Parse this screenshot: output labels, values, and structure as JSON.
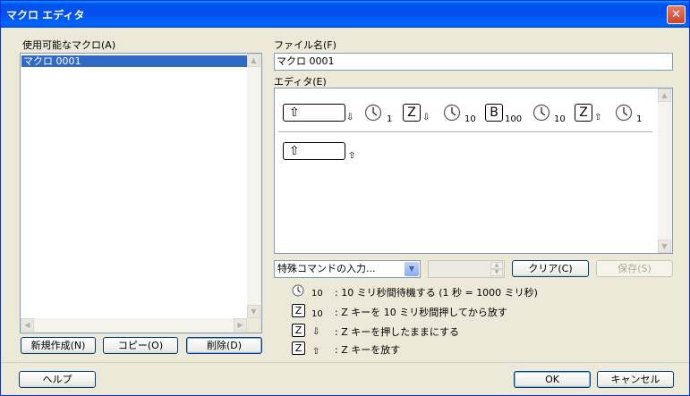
{
  "window": {
    "title": "マクロ エディタ",
    "close_glyph": "✕"
  },
  "macro_list": {
    "label": "使用可能なマクロ(A)",
    "items": [
      "マクロ 0001"
    ],
    "selected_index": 0
  },
  "list_buttons": {
    "new_label": "新規作成(N)",
    "copy_label": "コピー(O)",
    "delete_label": "削除(D)"
  },
  "filename": {
    "label": "ファイル名(F)",
    "value": "マクロ 0001"
  },
  "editor": {
    "label": "エディタ(E)",
    "row1": [
      {
        "type": "key",
        "icon": "shift-arrow-icon",
        "glyph": "⇧",
        "action": "down",
        "arrow": "⇩"
      },
      {
        "type": "wait",
        "icon": "clock-icon",
        "value": "1"
      },
      {
        "type": "key",
        "icon": "key-z-icon",
        "glyph": "Z",
        "action": "down",
        "arrow": "⇩"
      },
      {
        "type": "wait",
        "icon": "clock-icon",
        "value": "10"
      },
      {
        "type": "key",
        "icon": "key-b-icon",
        "glyph": "B",
        "value": "100"
      },
      {
        "type": "wait",
        "icon": "clock-icon",
        "value": "10"
      },
      {
        "type": "key",
        "icon": "key-z-icon",
        "glyph": "Z",
        "action": "up",
        "arrow": "⇧"
      },
      {
        "type": "wait",
        "icon": "clock-icon",
        "value": "1"
      }
    ],
    "row2": [
      {
        "type": "key",
        "icon": "shift-arrow-icon",
        "glyph": "⇧",
        "action": "up",
        "arrow": "⇧"
      }
    ]
  },
  "special_command": {
    "placeholder": "特殊コマンドの入力..."
  },
  "editor_buttons": {
    "clear_label": "クリア(C)",
    "save_label": "保存(S)"
  },
  "legend": [
    {
      "icon": "clock-icon",
      "glyph": "",
      "num": "10",
      "text": ": 10 ミリ秒間待機する (1 秒 = 1000 ミリ秒)"
    },
    {
      "icon": "key-z-icon",
      "glyph": "Z",
      "num": "10",
      "text": ": Z キーを 10 ミリ秒間押してから放す"
    },
    {
      "icon": "key-z-icon",
      "glyph": "Z",
      "num": "⇩",
      "text": ": Z キーを押したままにする"
    },
    {
      "icon": "key-z-icon",
      "glyph": "Z",
      "num": "⇧",
      "text": ": Z キーを放す"
    }
  ],
  "footer": {
    "help_label": "ヘルプ",
    "ok_label": "OK",
    "cancel_label": "キャンセル"
  }
}
